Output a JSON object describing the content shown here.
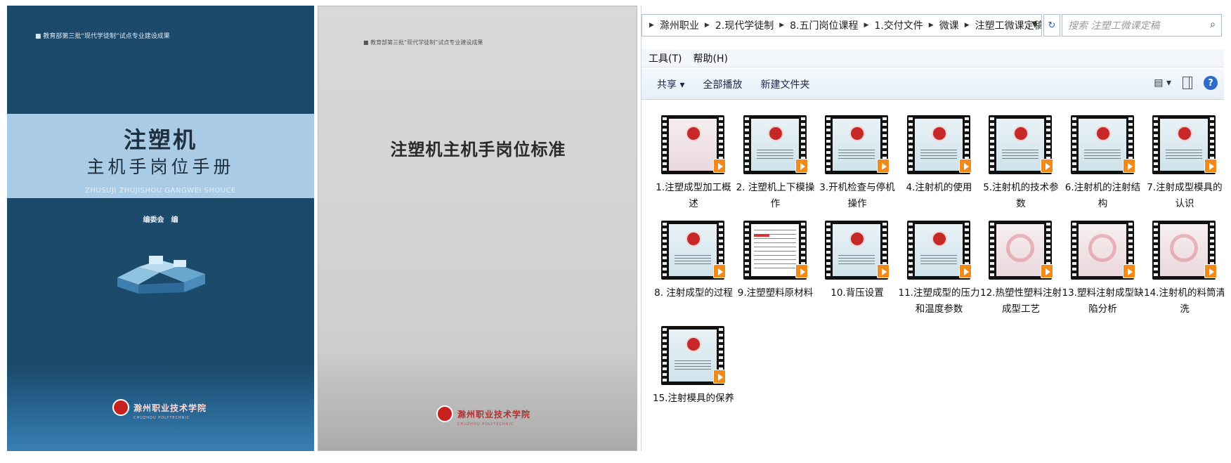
{
  "cover1": {
    "tag": "■ 教育部第三批“现代学徒制”试点专业建设成果",
    "title": "注塑机",
    "subtitle": "主机手岗位手册",
    "pinyin": "ZHUSUJI ZHUJISHOU GANGWEI SHOUCE",
    "editor": "编委会　编",
    "school": "滁州职业技术学院",
    "school_en": "CHUZHOU POLYTECHNIC"
  },
  "cover2": {
    "tag": "■ 教育部第三批“现代学徒制”试点专业建设成果",
    "title": "注塑机主机手岗位标准",
    "school": "滁州职业技术学院",
    "school_en": "CHUZHOU POLYTECHNIC"
  },
  "explorer": {
    "breadcrumbs": [
      "滁州职业",
      "2.现代学徒制",
      "8.五门岗位课程",
      "1.交付文件",
      "微课",
      "注塑工微课定稿"
    ],
    "search_placeholder": "搜索 注塑工微课定稿",
    "menu": [
      "工具(T)",
      "帮助(H)"
    ],
    "toolbar": {
      "share": "共享 ▾",
      "play_all": "全部播放",
      "new_folder": "新建文件夹"
    },
    "files": [
      {
        "label": "1.注塑成型加工概述",
        "thumb": "pink-emblem"
      },
      {
        "label": "2. 注塑机上下模操作",
        "thumb": "emblem"
      },
      {
        "label": "3.开机检查与停机操作",
        "thumb": "emblem"
      },
      {
        "label": "4.注射机的使用",
        "thumb": "emblem"
      },
      {
        "label": "5.注射机的技术参数",
        "thumb": "emblem"
      },
      {
        "label": "6.注射机的注射结构",
        "thumb": "emblem"
      },
      {
        "label": "7.注射成型模具的认识",
        "thumb": "emblem"
      },
      {
        "label": "8. 注射成型的过程",
        "thumb": "emblem"
      },
      {
        "label": "9.注塑塑料原材料",
        "thumb": "doc"
      },
      {
        "label": "10.背压设置",
        "thumb": "emblem"
      },
      {
        "label": "11.注塑成型的压力和温度参数",
        "thumb": "emblem"
      },
      {
        "label": "12.热塑性塑料注射成型工艺",
        "thumb": "swirl"
      },
      {
        "label": "13.塑料注射成型缺陷分析",
        "thumb": "swirl"
      },
      {
        "label": "14.注射机的料筒清洗",
        "thumb": "swirl"
      },
      {
        "label": "15.注射模具的保养",
        "thumb": "emblem"
      }
    ]
  }
}
